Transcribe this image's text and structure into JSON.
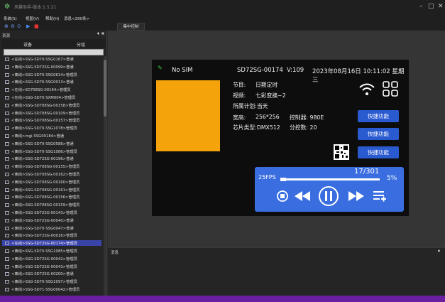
{
  "window": {
    "title": "风暴助手-版本:1.5.21"
  },
  "menu": [
    "系统(S)",
    "视图(V)",
    "帮助(H)",
    "消息<390条>"
  ],
  "left_panel": {
    "title": "资源",
    "pin": "♦ ✖",
    "tabs": [
      "设备",
      "分组"
    ],
    "devices": [
      "<在线>SSG-SD70-SSG0167>普通",
      "<离线>SSG-SD72SG-00099>普通",
      "<离线>SSG-SD70-SSG0614>管理员",
      "<离线>SSG-SD70-SSG0013>普通",
      "<在线>SD708SG-00164>管理员",
      "<在线>SSG-SD70-SXM004>管理员",
      "<离线>SSG-SD708SG-00158>管理员",
      "<离线>SSG-SD708SG-00109>管理员",
      "<离线>SSG-SD708SG-00157>管理员",
      "<离线>SSG-SD70-SSG1078>管理员",
      "<离线>mgi-SSG00184>普通",
      "<离线>SSG-SD70-SSG0588>普通",
      "<离线>SSG-SD70-SSG1086>管理员",
      "<离线>SSG-SD72SG-00196>普通",
      "<离线>SSG-SD708SG-00155>管理员",
      "<离线>SSG-SD708SG-00162>管理员",
      "<离线>SSG-SD708SG-00160>管理员",
      "<离线>SSG-SD708SG-00161>管理员",
      "<离线>SSG-SD708SG-00156>管理员",
      "<离线>SSG-SD708SG-00159>管理员",
      "<离线>SSG-SD72SG-00143>管理员",
      "<离线>SSG-SD72SG-00040>普通",
      "<离线>SSG-SD70-SSG0047>普通",
      "<离线>SSG-SD72SG-00016>管理员",
      "<在线>SSG-SD72SG-00174>管理员",
      "<离线>SSG-SD70-SSG1085>管理员",
      "<离线>SSG-SD72SG-00042>管理员",
      "<离线>SSG-SD72SG-00043>管理员",
      "<离线>SSG-SD72SG-00200>普通",
      "<离线>SSG-SD70-SSG1097>管理员",
      "<离线>SSG-SD71-SSG00042>管理员"
    ],
    "selected_index": 24
  },
  "doc_tab": "集中控制",
  "monitor": {
    "sim": "No SIM",
    "device_id": "SD72SG-00174",
    "version": "V:109",
    "datetime": "2023年08月16日 10:11:02 星期三",
    "program_label": "节目:",
    "program_value": "日期定时",
    "video_label": "视频:",
    "video_value": "七彩变换~2",
    "plan": "所属计划:当天",
    "size_label": "宽高:",
    "size_value": "256*256",
    "controller": "控制器: 980E",
    "chip": "芯片类型:DMX512",
    "split": "分控数: 20",
    "quick_buttons": [
      "快捷功能",
      "快捷功能",
      "快捷功能"
    ],
    "fps": "25FPS",
    "track": "17/301",
    "volume": "5%",
    "progress_fraction": 0.056
  },
  "bottom_panel": {
    "title": "消息",
    "pin": "♦"
  },
  "colors": {
    "accent": "#3a6ee0",
    "poster": "#f5a30a",
    "status": "#6a1fa0",
    "selected": "#3a44a8"
  }
}
